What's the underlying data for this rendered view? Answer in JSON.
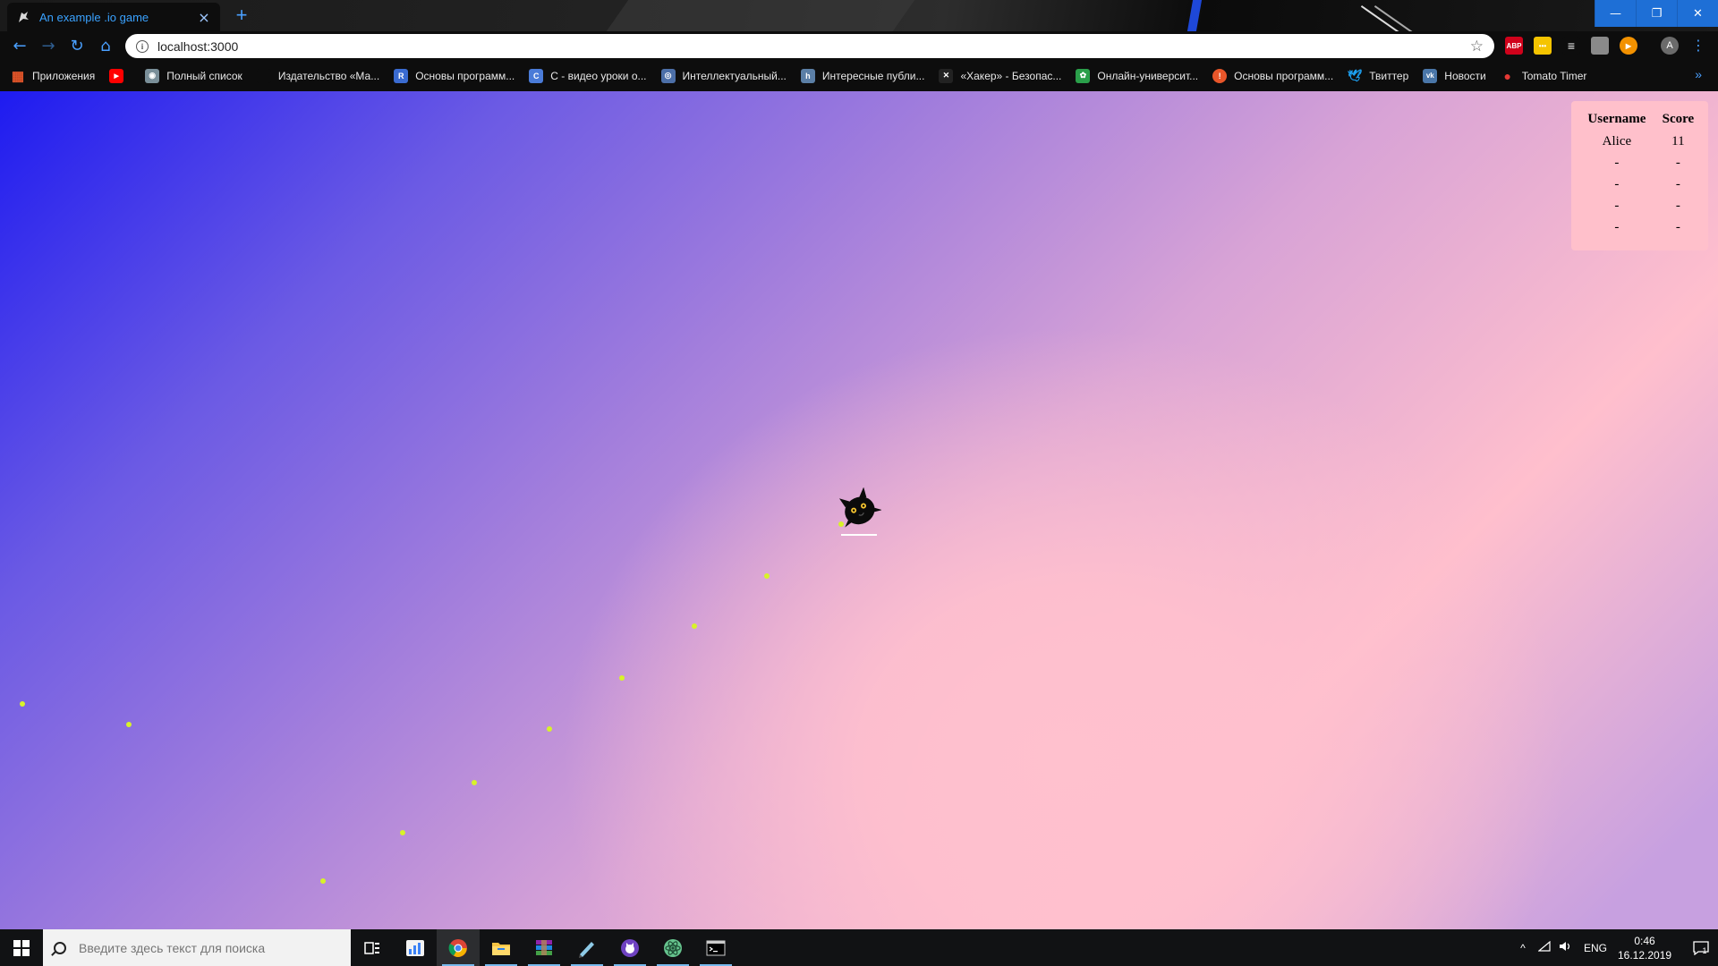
{
  "browser": {
    "tab_title": "An example .io game",
    "tab_close": "×",
    "new_tab": "+",
    "url": "localhost:3000",
    "nav": {
      "back": "←",
      "forward": "→",
      "reload": "↻",
      "home": "⌂"
    },
    "star": "☆",
    "window_buttons": {
      "minimize": "—",
      "maximize": "❐",
      "close": "✕"
    },
    "extensions": [
      {
        "label": "ABP",
        "color": "#d0021b",
        "icon": "adblock-icon"
      },
      {
        "label": "•••",
        "color": "#f5c400",
        "icon": "extension-yellow-icon"
      },
      {
        "label": "≡",
        "color": "#0d0d0d",
        "icon": "extension-list-icon"
      },
      {
        "label": "",
        "color": "#8a8a8a",
        "icon": "extension-grey-icon"
      },
      {
        "label": "▶",
        "color": "#f29100",
        "icon": "extension-play-icon"
      }
    ],
    "avatar_letter": "A",
    "menu": "⋮",
    "bookmarks": [
      {
        "label": "Приложения",
        "icon": "apps-grid-icon",
        "color": "#e8572a",
        "glyph": "▦"
      },
      {
        "label": "",
        "icon": "youtube-icon",
        "color": "#ff0000",
        "glyph": "▶"
      },
      {
        "label": "Полный список",
        "icon": "android-icon",
        "color": "#7a8f99",
        "glyph": "◉"
      },
      {
        "label": "Издательство «Ма...",
        "icon": "publisher-icon",
        "color": "#0d0d0d",
        "glyph": ""
      },
      {
        "label": "Основы программ...",
        "icon": "docs-icon",
        "color": "#3a6bd1",
        "glyph": "R"
      },
      {
        "label": "С - видео уроки о...",
        "icon": "video-lessons-icon",
        "color": "#4a7bd8",
        "glyph": "C"
      },
      {
        "label": "Интеллектуальный...",
        "icon": "globe-icon",
        "color": "#4c6fa8",
        "glyph": "◎"
      },
      {
        "label": "Интересные публи...",
        "icon": "habr-icon",
        "color": "#5b7fa6",
        "glyph": "h"
      },
      {
        "label": "«Хакер» - Безопас...",
        "icon": "xakep-icon",
        "color": "#222222",
        "glyph": "✕"
      },
      {
        "label": "Онлайн-университ...",
        "icon": "university-icon",
        "color": "#2a9f4a",
        "glyph": "✿"
      },
      {
        "label": "Основы программ...",
        "icon": "stepik-icon",
        "color": "#e8562a",
        "glyph": "!"
      },
      {
        "label": "Твиттер",
        "icon": "twitter-icon",
        "color": "#1da1f2",
        "glyph": "🕊"
      },
      {
        "label": "Новости",
        "icon": "vk-icon",
        "color": "#4a76a8",
        "glyph": "vk"
      },
      {
        "label": "Tomato Timer",
        "icon": "tomato-icon",
        "color": "#e53935",
        "glyph": "●"
      }
    ],
    "bookmarks_more": "»"
  },
  "leaderboard": {
    "headers": [
      "Username",
      "Score"
    ],
    "rows": [
      [
        "Alice",
        "11"
      ],
      [
        "-",
        "-"
      ],
      [
        "-",
        "-"
      ],
      [
        "-",
        "-"
      ],
      [
        "-",
        "-"
      ]
    ]
  },
  "game": {
    "food_count": 11,
    "food_color": "#d8f229"
  },
  "taskbar": {
    "search_placeholder": "Введите здесь текст для поиска",
    "apps": [
      {
        "name": "task-view-icon",
        "active": false
      },
      {
        "name": "app-widget-icon",
        "active": false
      },
      {
        "name": "chrome-icon",
        "active": true
      },
      {
        "name": "file-explorer-icon",
        "active": false
      },
      {
        "name": "winrar-icon",
        "active": false
      },
      {
        "name": "notepad-icon",
        "active": false
      },
      {
        "name": "github-desktop-icon",
        "active": false
      },
      {
        "name": "atom-icon",
        "active": false
      },
      {
        "name": "terminal-icon",
        "active": false
      }
    ],
    "tray": {
      "chevron": "^",
      "language": "ENG",
      "time": "0:46",
      "date": "16.12.2019",
      "notifications": "1"
    }
  }
}
